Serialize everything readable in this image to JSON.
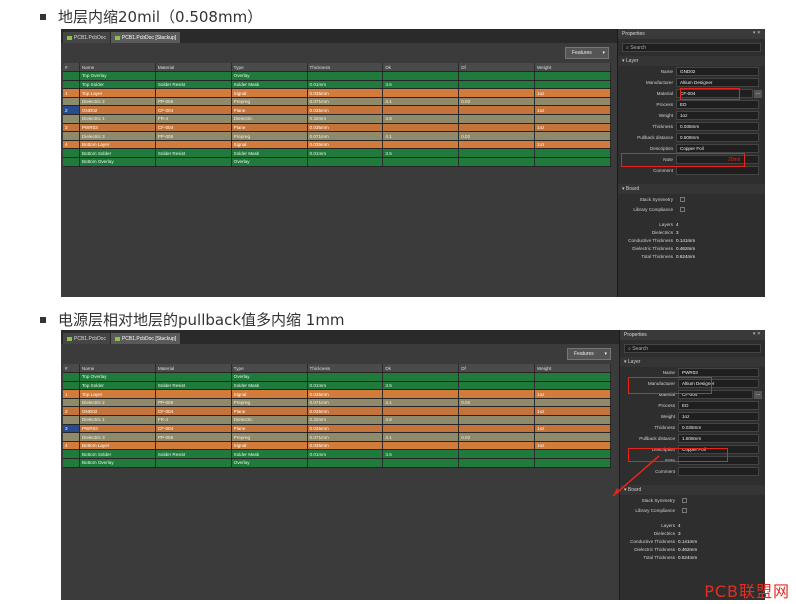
{
  "headings": [
    "地层内缩20mil（0.508mm）",
    "电源层相对地层的pullback值多内缩 1mm"
  ],
  "tabs": [
    "PCB1.PcbDoc",
    "PCB1.PcbDoc [Stackup]"
  ],
  "features_label": "Features",
  "columns": [
    "#",
    "Name",
    "Material",
    "Type",
    "Thickness",
    "Dk",
    "Df",
    "Weight"
  ],
  "colors": {
    "overlay": "#1f7a3c",
    "signal": "#d27b3a",
    "dielectric": "#8f8a6c",
    "plane": "#c4743a",
    "annotation": "#e5251a"
  },
  "panels": [
    {
      "layers": [
        {
          "num": "",
          "name": "Top Overlay",
          "material": "",
          "type": "Overlay",
          "thickness": "",
          "dk": "",
          "df": "",
          "weight": "",
          "kind": "overlay"
        },
        {
          "num": "",
          "name": "Top Solder",
          "material": "Solder Resist",
          "type": "Solder Mask",
          "thickness": "0.01mm",
          "dk": "3.5",
          "df": "",
          "weight": "",
          "kind": "solder"
        },
        {
          "num": "1",
          "name": "Top Layer",
          "material": "",
          "type": "Signal",
          "thickness": "0.035mm",
          "dk": "",
          "df": "",
          "weight": "1oz",
          "kind": "signal"
        },
        {
          "num": "",
          "name": "Dielectric 2",
          "material": "PP-006",
          "type": "Prepreg",
          "thickness": "0.071mm",
          "dk": "4.1",
          "df": "0.02",
          "weight": "",
          "kind": "dielec"
        },
        {
          "num": "2",
          "name": "GND02",
          "material": "CF-004",
          "type": "Plane",
          "thickness": "0.035mm",
          "dk": "",
          "df": "",
          "weight": "1oz",
          "kind": "plane",
          "selected": true
        },
        {
          "num": "",
          "name": "Dielectric 1",
          "material": "FR-4",
          "type": "Dielectric",
          "thickness": "0.32mm",
          "dk": "4.8",
          "df": "",
          "weight": "",
          "kind": "dielec"
        },
        {
          "num": "3",
          "name": "PWR03",
          "material": "CF-004",
          "type": "Plane",
          "thickness": "0.035mm",
          "dk": "",
          "df": "",
          "weight": "1oz",
          "kind": "plane"
        },
        {
          "num": "",
          "name": "Dielectric 3",
          "material": "PP-006",
          "type": "Prepreg",
          "thickness": "0.071mm",
          "dk": "4.1",
          "df": "0.02",
          "weight": "",
          "kind": "dielec"
        },
        {
          "num": "4",
          "name": "Bottom Layer",
          "material": "",
          "type": "Signal",
          "thickness": "0.035mm",
          "dk": "",
          "df": "",
          "weight": "1oz",
          "kind": "signal"
        },
        {
          "num": "",
          "name": "Bottom Solder",
          "material": "Solder Resist",
          "type": "Solder Mask",
          "thickness": "0.01mm",
          "dk": "3.5",
          "df": "",
          "weight": "",
          "kind": "solder"
        },
        {
          "num": "",
          "name": "Bottom Overlay",
          "material": "",
          "type": "Overlay",
          "thickness": "",
          "dk": "",
          "df": "",
          "weight": "",
          "kind": "overlay"
        }
      ],
      "props": {
        "title": "Properties",
        "search": "Search",
        "layer_section": "Layer",
        "board_section": "Board",
        "fields": [
          {
            "label": "Name",
            "value": "GND02"
          },
          {
            "label": "Manufacturer",
            "value": "Altium Designer"
          },
          {
            "label": "Material",
            "value": "CF-004",
            "btn": true
          },
          {
            "label": "Process",
            "value": "ED"
          },
          {
            "label": "Weight",
            "value": "1oz"
          },
          {
            "label": "Thickness",
            "value": "0.035mm"
          },
          {
            "label": "Pullback distance",
            "value": "0.508mm"
          },
          {
            "label": "Description",
            "value": "Copper Foil"
          },
          {
            "label": "Note",
            "value": ""
          },
          {
            "label": "Comment",
            "value": ""
          }
        ],
        "checks": [
          "Stack Symmetry",
          "Library Compliance"
        ],
        "stats": [
          {
            "label": "Layers",
            "value": "4"
          },
          {
            "label": "Dielectrics",
            "value": "3"
          },
          {
            "label": "Conductive Thickness",
            "value": "0.141mm"
          },
          {
            "label": "Dielectric Thickness",
            "value": "0.462mm"
          },
          {
            "label": "Total Thickness",
            "value": "0.624mm"
          }
        ],
        "red_note": "20mil"
      }
    },
    {
      "layers": [
        {
          "num": "",
          "name": "Top Overlay",
          "material": "",
          "type": "Overlay",
          "thickness": "",
          "dk": "",
          "df": "",
          "weight": "",
          "kind": "overlay"
        },
        {
          "num": "",
          "name": "Top Solder",
          "material": "Solder Resist",
          "type": "Solder Mask",
          "thickness": "0.01mm",
          "dk": "3.5",
          "df": "",
          "weight": "",
          "kind": "solder"
        },
        {
          "num": "1",
          "name": "Top Layer",
          "material": "",
          "type": "Signal",
          "thickness": "0.035mm",
          "dk": "",
          "df": "",
          "weight": "1oz",
          "kind": "signal"
        },
        {
          "num": "",
          "name": "Dielectric 2",
          "material": "PP-006",
          "type": "Prepreg",
          "thickness": "0.071mm",
          "dk": "4.1",
          "df": "0.02",
          "weight": "",
          "kind": "dielec"
        },
        {
          "num": "2",
          "name": "GND02",
          "material": "CF-004",
          "type": "Plane",
          "thickness": "0.035mm",
          "dk": "",
          "df": "",
          "weight": "1oz",
          "kind": "plane"
        },
        {
          "num": "",
          "name": "Dielectric 1",
          "material": "FR-4",
          "type": "Dielectric",
          "thickness": "0.32mm",
          "dk": "4.8",
          "df": "",
          "weight": "",
          "kind": "dielec"
        },
        {
          "num": "3",
          "name": "PWR03",
          "material": "CF-004",
          "type": "Plane",
          "thickness": "0.035mm",
          "dk": "",
          "df": "",
          "weight": "1oz",
          "kind": "plane",
          "selected": true
        },
        {
          "num": "",
          "name": "Dielectric 3",
          "material": "PP-006",
          "type": "Prepreg",
          "thickness": "0.071mm",
          "dk": "4.1",
          "df": "0.02",
          "weight": "",
          "kind": "dielec"
        },
        {
          "num": "4",
          "name": "Bottom Layer",
          "material": "",
          "type": "Signal",
          "thickness": "0.035mm",
          "dk": "",
          "df": "",
          "weight": "1oz",
          "kind": "signal"
        },
        {
          "num": "",
          "name": "Bottom Solder",
          "material": "Solder Resist",
          "type": "Solder Mask",
          "thickness": "0.01mm",
          "dk": "3.5",
          "df": "",
          "weight": "",
          "kind": "solder"
        },
        {
          "num": "",
          "name": "Bottom Overlay",
          "material": "",
          "type": "Overlay",
          "thickness": "",
          "dk": "",
          "df": "",
          "weight": "",
          "kind": "overlay"
        }
      ],
      "props": {
        "title": "Properties",
        "search": "Search",
        "layer_section": "Layer",
        "board_section": "Board",
        "fields": [
          {
            "label": "Name",
            "value": "PWR03"
          },
          {
            "label": "Manufacturer",
            "value": "Altium Designer"
          },
          {
            "label": "Material",
            "value": "CF-004",
            "btn": true
          },
          {
            "label": "Process",
            "value": "ED"
          },
          {
            "label": "Weight",
            "value": "1oz"
          },
          {
            "label": "Thickness",
            "value": "0.035mm"
          },
          {
            "label": "Pullback distance",
            "value": "1.508mm"
          },
          {
            "label": "Description",
            "value": "Copper Foil"
          },
          {
            "label": "Note",
            "value": ""
          },
          {
            "label": "Comment",
            "value": ""
          }
        ],
        "checks": [
          "Stack Symmetry",
          "Library Compliance"
        ],
        "stats": [
          {
            "label": "Layers",
            "value": "4"
          },
          {
            "label": "Dielectrics",
            "value": "3"
          },
          {
            "label": "Conductive Thickness",
            "value": "0.141mm"
          },
          {
            "label": "Dielectric Thickness",
            "value": "0.462mm"
          },
          {
            "label": "Total Thickness",
            "value": "0.624mm"
          }
        ],
        "red_note": ""
      }
    }
  ],
  "watermark": "PCB联盟网"
}
